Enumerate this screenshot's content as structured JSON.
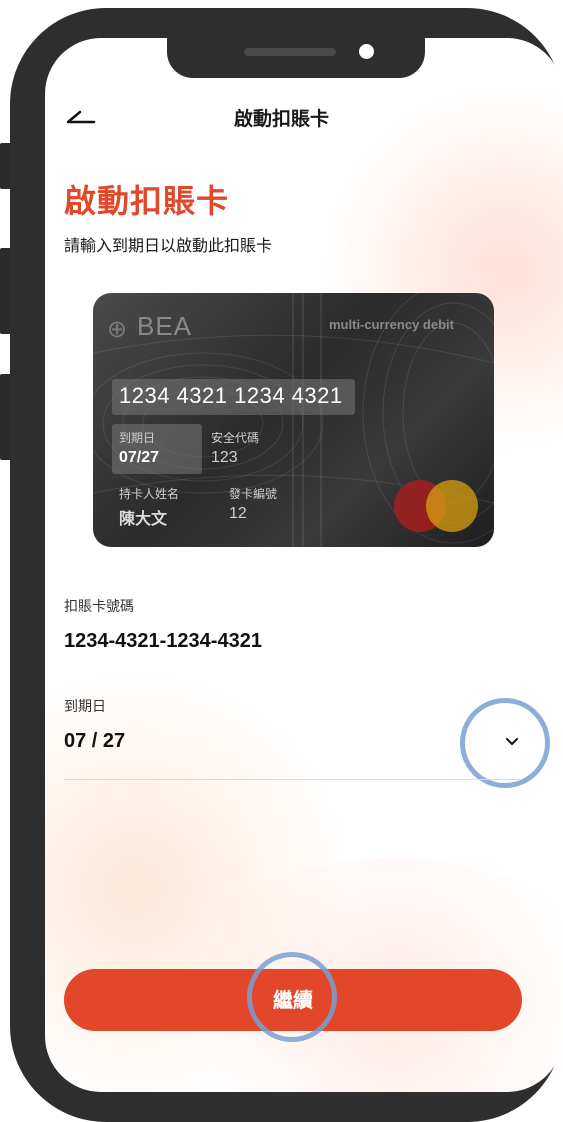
{
  "nav": {
    "title": "啟動扣賬卡"
  },
  "page": {
    "heading": "啟動扣賬卡",
    "subtitle": "請輸入到期日以啟動此扣賬卡"
  },
  "card": {
    "brand": "BEA",
    "type": "multi-currency debit",
    "number": "1234 4321 1234 4321",
    "expiry_label": "到期日",
    "expiry_value": "07/27",
    "cvv_label": "安全代碼",
    "cvv_value": "123",
    "holder_label": "持卡人姓名",
    "holder_value": "陳大文",
    "issue_label": "發卡編號",
    "issue_value": "12"
  },
  "form": {
    "card_number_label": "扣賬卡號碼",
    "card_number_value": "1234-4321-1234-4321",
    "expiry_label": "到期日",
    "expiry_value": "07 / 27"
  },
  "cta": {
    "label": "繼續"
  },
  "colors": {
    "accent": "#e2472a",
    "highlight_ring": "#78a0d2"
  }
}
